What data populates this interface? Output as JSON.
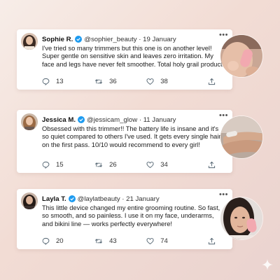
{
  "posts": [
    {
      "name": "Sophie R.",
      "handle": "@sophier_beauty",
      "date": "19 January",
      "text": "I've tried so many trimmers but this one is on another level! Super gentle on sensitive skin and leaves zero irritation. My face and legs have never felt smoother. Total holy grail product!",
      "replies": "13",
      "reposts": "36",
      "likes": "38"
    },
    {
      "name": "Jessica M.",
      "handle": "@jessicam_glow",
      "date": "11 January",
      "text": "Obsessed with this trimmer!! The battery life is insane and it's so quiet compared to others I've used. It gets every single hair on the first pass. 10/10 would recommend to every girl!",
      "replies": "15",
      "reposts": "26",
      "likes": "34"
    },
    {
      "name": "Layla T.",
      "handle": "@laylatbeauty",
      "date": "21 January",
      "text": "This little device changed my entire grooming routine. So fast, so smooth, and so painless. I use it on my face, underarms, and bikini line — works perfectly everywhere!",
      "replies": "20",
      "reposts": "43",
      "likes": "74"
    }
  ],
  "separator": "·",
  "more_label": "•••",
  "colors": {
    "verified": "#1d9bf0",
    "background_start": "#f7ede8",
    "background_end": "#ead3cf",
    "device_pink": "#f2a9b0"
  },
  "icons": [
    "more-icon",
    "verified-icon",
    "reply-icon",
    "repost-icon",
    "like-icon",
    "share-icon",
    "sparkle-icon"
  ]
}
